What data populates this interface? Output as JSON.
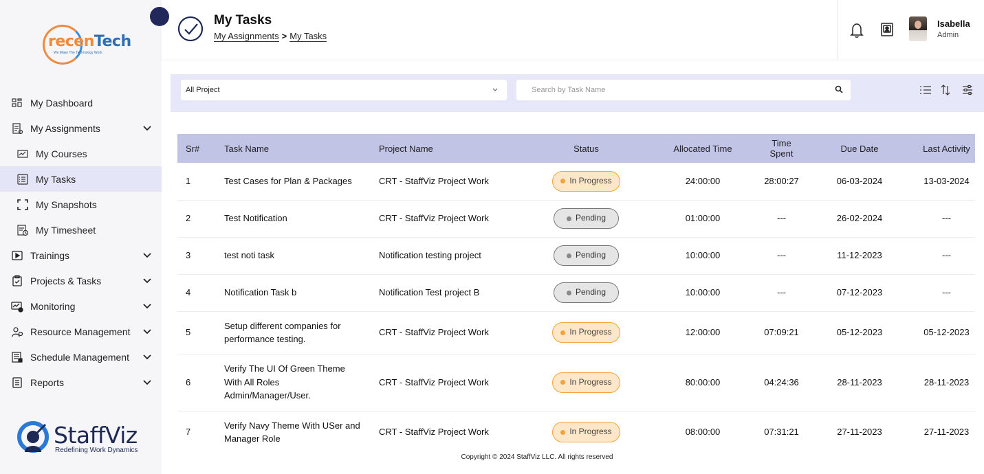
{
  "brand": {
    "top_logo_part1": "recen",
    "top_logo_part2": "Tech",
    "top_logo_tagline": "We Make The Technology Work",
    "bottom_logo_name": "StaffViz",
    "bottom_logo_tagline": "Redefining Work Dynamics"
  },
  "sidebar": {
    "items": [
      {
        "label": "My Dashboard",
        "icon": "dashboard-icon"
      },
      {
        "label": "My Assignments",
        "icon": "assignments-icon",
        "expandable": true
      },
      {
        "label": "My Courses",
        "icon": "courses-icon",
        "sub": true
      },
      {
        "label": "My Tasks",
        "icon": "tasks-icon",
        "sub": true,
        "active": true
      },
      {
        "label": "My Snapshots",
        "icon": "snapshot-icon",
        "sub": true
      },
      {
        "label": "My Timesheet",
        "icon": "timesheet-icon",
        "sub": true
      },
      {
        "label": "Trainings",
        "icon": "trainings-icon",
        "expandable": true
      },
      {
        "label": "Projects & Tasks",
        "icon": "projects-icon",
        "expandable": true
      },
      {
        "label": "Monitoring",
        "icon": "monitoring-icon",
        "expandable": true
      },
      {
        "label": "Resource Management",
        "icon": "resource-icon",
        "expandable": true
      },
      {
        "label": "Schedule Management",
        "icon": "schedule-icon",
        "expandable": true
      },
      {
        "label": "Reports",
        "icon": "reports-icon",
        "expandable": true
      }
    ]
  },
  "header": {
    "title": "My Tasks",
    "breadcrumb": [
      "My Assignments",
      "My Tasks"
    ],
    "breadcrumb_sep": ">",
    "user_name": "Isabella",
    "user_role": "Admin"
  },
  "filters": {
    "project_select": "All Project",
    "search_placeholder": "Search by Task Name"
  },
  "table": {
    "columns": [
      "Sr#",
      "Task Name",
      "Project Name",
      "Status",
      "Allocated Time",
      "Time Spent",
      "Due Date",
      "Last Activity"
    ],
    "rows": [
      {
        "sr": "1",
        "task": "Test Cases for Plan & Packages",
        "project": "CRT - StaffViz Project Work",
        "status": "In Progress",
        "allocated": "24:00:00",
        "spent": "28:00:27",
        "due": "06-03-2024",
        "last": "13-03-2024"
      },
      {
        "sr": "2",
        "task": "Test Notification",
        "project": "CRT - StaffViz Project Work",
        "status": "Pending",
        "allocated": "01:00:00",
        "spent": "---",
        "due": "26-02-2024",
        "last": "---"
      },
      {
        "sr": "3",
        "task": "test noti task",
        "project": "Notification testing project",
        "status": "Pending",
        "allocated": "10:00:00",
        "spent": "---",
        "due": "11-12-2023",
        "last": "---"
      },
      {
        "sr": "4",
        "task": "Notification Task b",
        "project": "Notification Test project B",
        "status": "Pending",
        "allocated": "10:00:00",
        "spent": "---",
        "due": "07-12-2023",
        "last": "---"
      },
      {
        "sr": "5",
        "task": "Setup different companies for performance testing.",
        "project": "CRT - StaffViz Project Work",
        "status": "In Progress",
        "allocated": "12:00:00",
        "spent": "07:09:21",
        "due": "05-12-2023",
        "last": "05-12-2023"
      },
      {
        "sr": "6",
        "task": "Verify The UI Of Green Theme With All Roles Admin/Manager/User.",
        "project": "CRT - StaffViz Project Work",
        "status": "In Progress",
        "allocated": "80:00:00",
        "spent": "04:24:36",
        "due": "28-11-2023",
        "last": "28-11-2023"
      },
      {
        "sr": "7",
        "task": "Verify Navy Theme With USer and Manager Role",
        "project": "CRT - StaffViz Project Work",
        "status": "In Progress",
        "allocated": "08:00:00",
        "spent": "07:31:21",
        "due": "27-11-2023",
        "last": "27-11-2023"
      }
    ]
  },
  "footer": {
    "copyright": "Copyright © 2024 StaffViz LLC. All rights reserved"
  },
  "colors": {
    "accent_navy": "#23285a",
    "header_row": "#c2c4e6",
    "filter_bar": "#e6e7f8",
    "in_progress": "#f2a33a",
    "pending": "#888888"
  }
}
